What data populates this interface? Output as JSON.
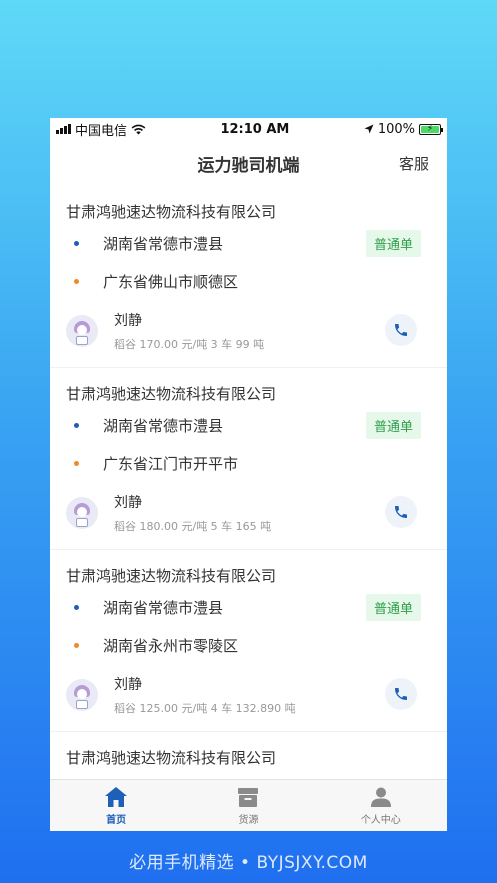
{
  "status_bar": {
    "carrier": "中国电信",
    "time": "12:10 AM",
    "battery": "100%"
  },
  "header": {
    "title": "运力驰司机端",
    "service_label": "客服"
  },
  "orders": [
    {
      "company": "甘肃鸿驰速达物流科技有限公司",
      "origin": "湖南省常德市澧县",
      "destination": "广东省佛山市顺德区",
      "badge": "普通单",
      "driver": "刘静",
      "cargo": "稻谷 170.00 元/吨 3 车 99 吨"
    },
    {
      "company": "甘肃鸿驰速达物流科技有限公司",
      "origin": "湖南省常德市澧县",
      "destination": "广东省江门市开平市",
      "badge": "普通单",
      "driver": "刘静",
      "cargo": "稻谷 180.00 元/吨 5 车 165 吨"
    },
    {
      "company": "甘肃鸿驰速达物流科技有限公司",
      "origin": "湖南省常德市澧县",
      "destination": "湖南省永州市零陵区",
      "badge": "普通单",
      "driver": "刘静",
      "cargo": "稻谷 125.00 元/吨 4 车 132.890 吨"
    },
    {
      "company": "甘肃鸿驰速达物流科技有限公司"
    }
  ],
  "tabs": [
    {
      "label": "首页",
      "icon": "home-icon",
      "active": true
    },
    {
      "label": "货源",
      "icon": "cargo-box-icon",
      "active": false
    },
    {
      "label": "个人中心",
      "icon": "person-icon",
      "active": false
    }
  ],
  "watermark": "必用手机精选 • BYJSJXY.COM",
  "colors": {
    "accent": "#1e5fb8",
    "origin_dot": "#1e5fb8",
    "destination_dot": "#f08a24",
    "badge_text": "#2f9e4b",
    "badge_bg": "#e6f8ea"
  }
}
